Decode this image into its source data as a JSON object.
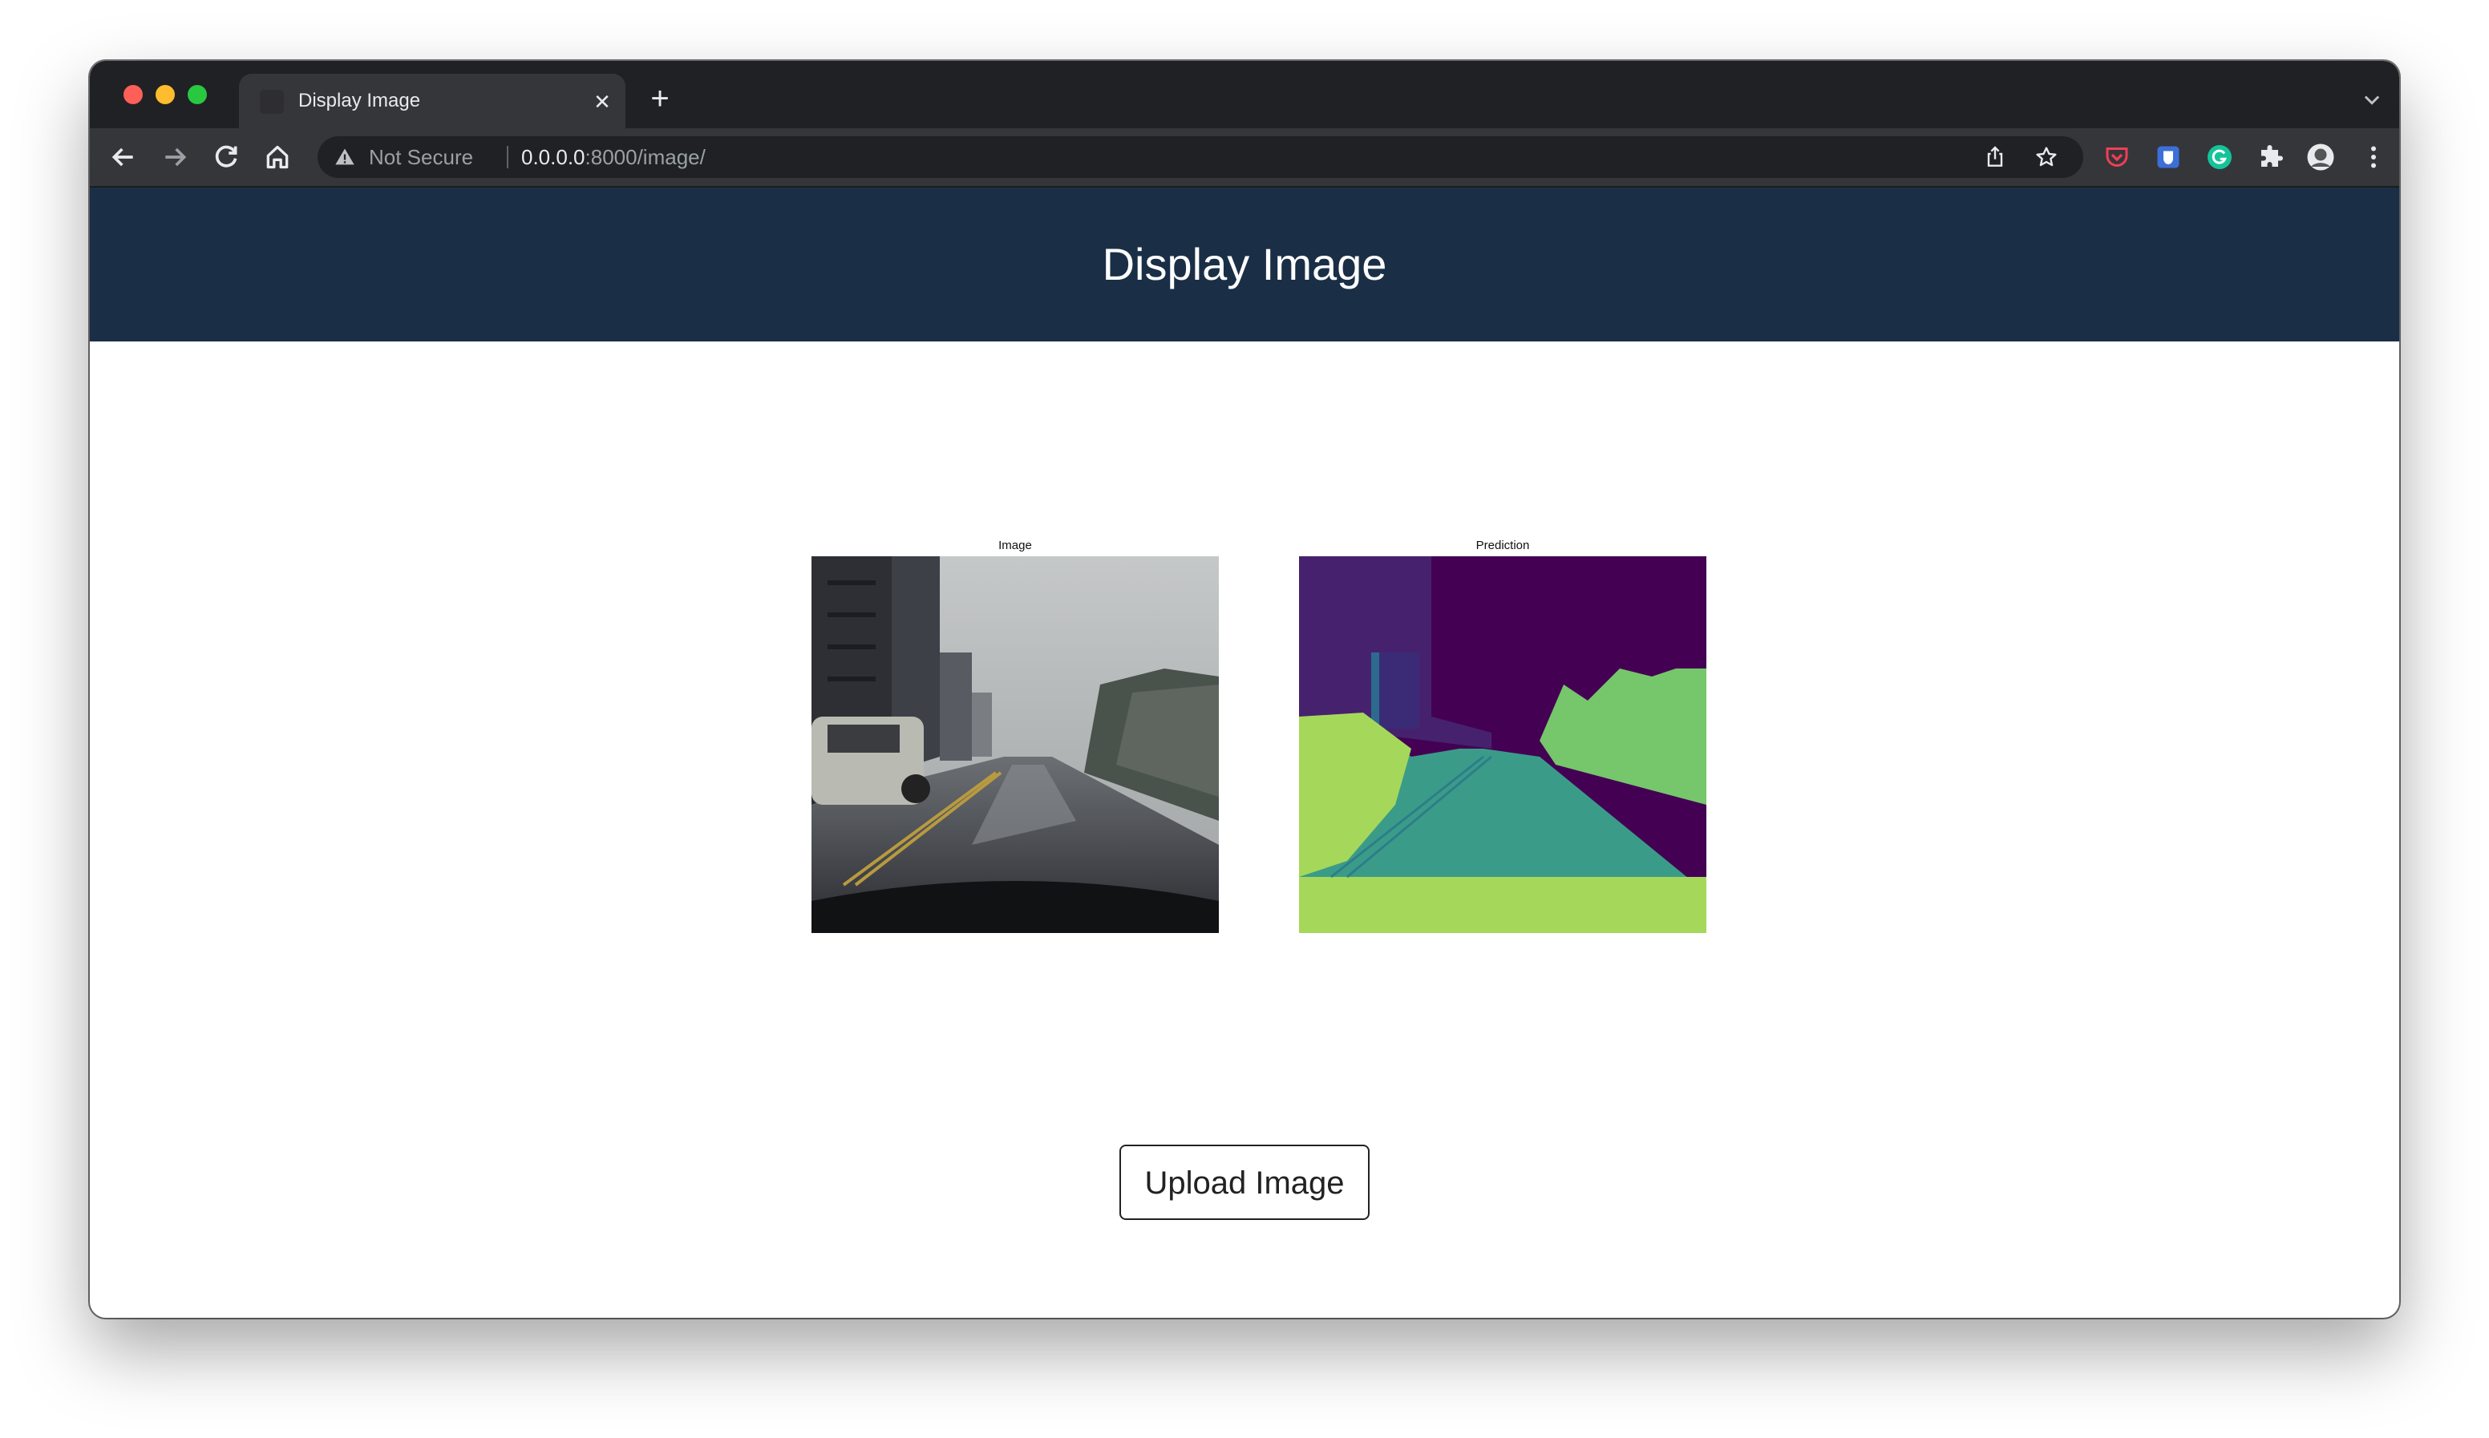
{
  "browser": {
    "tab_title": "Display Image",
    "security_label": "Not Secure",
    "url_host": "0.0.0.0",
    "url_rest": ":8000/image/"
  },
  "page": {
    "title": "Display Image",
    "figures": [
      {
        "caption": "Image"
      },
      {
        "caption": "Prediction"
      }
    ],
    "upload_button": "Upload Image"
  },
  "colors": {
    "header_bg": "#1a2f46",
    "segmentation_sky": "#440154",
    "segmentation_building": "#46226e",
    "segmentation_road": "#3a9c88",
    "segmentation_vegetation": "#a5d85a",
    "segmentation_sidewalk": "#76c66b"
  }
}
